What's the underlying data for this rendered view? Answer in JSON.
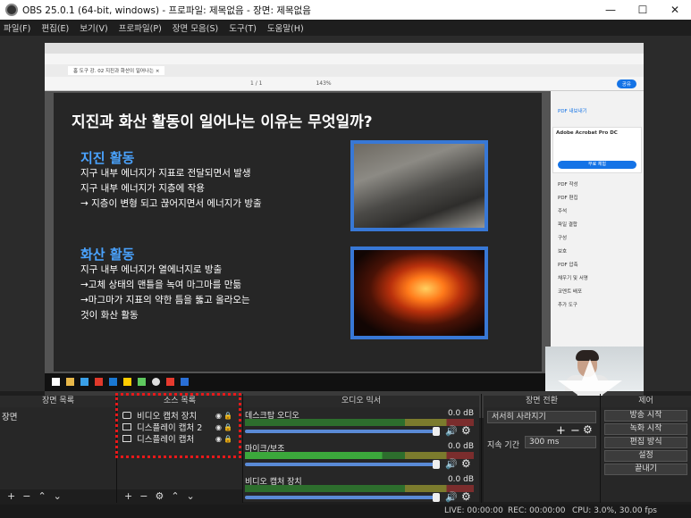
{
  "window": {
    "title": "OBS 25.0.1 (64-bit, windows) - 프로파일: 제목없음 - 장면: 제목없음",
    "minimize": "—",
    "maximize": "☐",
    "close": "✕"
  },
  "menu": [
    "파일(F)",
    "편집(E)",
    "보기(V)",
    "프로파일(P)",
    "장면 모음(S)",
    "도구(T)",
    "도움말(H)"
  ],
  "preview": {
    "slide": {
      "title": "지진과 화산 활동이 일어나는 이유는 무엇일까?",
      "section1_title": "지진 활동",
      "section1_text": "지구 내부 에너지가 지표로 전달되면서 발생\n지구 내부 에너지가 지층에 작용\n→ 지층이 변형 되고 끊어지면서 에너지가 방출",
      "section2_title": "화산 활동",
      "section2_text": "지구 내부 에너지가 열에너지로 방출\n→고체 상태의 맨틀을 녹여 마그마를 만듦\n→마그마가 지표의 약한 틈을 뚫고 올라오는\n것이 화산 활동"
    },
    "reader": {
      "tab": "홈   도구      강. 02 지진과 화산이 일어나는 ×",
      "share": "공유",
      "page": "1 / 1",
      "zoom": "143%",
      "promo_title": "Adobe Acrobat Pro DC",
      "promo_btn": "무료 체험",
      "tools": [
        "PDF 내보내기",
        "PDF 작성",
        "PDF 편집",
        "주석",
        "파일 결합",
        "구성",
        "보호",
        "PDF 압축",
        "채우기 및 서명",
        "코멘트 배포",
        "추가 도구"
      ]
    }
  },
  "docks": {
    "scenes_header": "장면 목록",
    "sources_header": "소스 목록",
    "mixer_header": "오디오 믹서",
    "transitions_header": "장면 전환",
    "controls_header": "제어"
  },
  "scenes": [
    "장면"
  ],
  "sources": [
    {
      "name": "비디오 캡처 장치",
      "icon": "camera-icon"
    },
    {
      "name": "디스플레이 캡처 2",
      "icon": "monitor-icon"
    },
    {
      "name": "디스플레이 캡처",
      "icon": "monitor-icon"
    }
  ],
  "mixer": [
    {
      "name": "데스크탑 오디오",
      "db": "0.0 dB"
    },
    {
      "name": "마이크/보조",
      "db": "0.0 dB"
    },
    {
      "name": "비디오 캡처 장치",
      "db": "0.0 dB"
    }
  ],
  "transitions": {
    "type": "서서히 사라지기",
    "duration_label": "지속 기간",
    "duration": "300 ms"
  },
  "controls": [
    "방송 시작",
    "녹화 시작",
    "편집 방식",
    "설정",
    "끝내기"
  ],
  "status": {
    "live": "LIVE: 00:00:00",
    "rec": "REC: 00:00:00",
    "cpu": "CPU: 3.0%, 30.00 fps"
  }
}
